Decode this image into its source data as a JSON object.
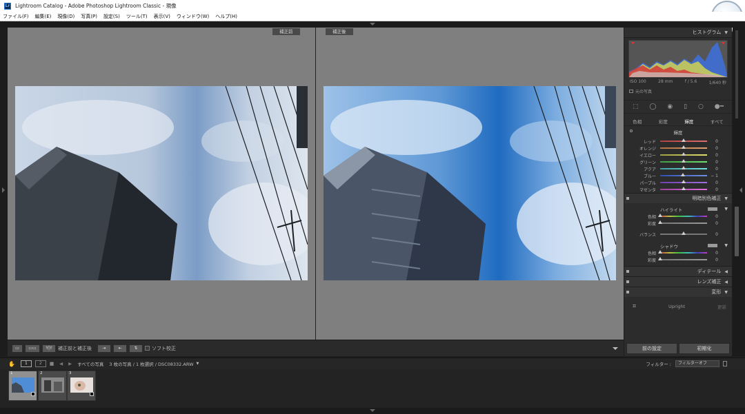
{
  "window": {
    "logo": "Lr",
    "title": "Lightroom Catalog - Adobe Photoshop Lightroom Classic - 現像"
  },
  "menu": [
    "ファイル(F)",
    "編集(E)",
    "現像(D)",
    "写真(P)",
    "設定(S)",
    "ツール(T)",
    "表示(V)",
    "ウィンドウ(W)",
    "ヘルプ(H)"
  ],
  "view": {
    "before_label": "補正前",
    "after_label": "補正後"
  },
  "toolbar": {
    "view_mode_label": "補正前と補正後",
    "soft_proof_label": "ソフト校正",
    "yy_label": "Y|Y"
  },
  "right_panel": {
    "histogram_title": "ヒストグラム",
    "exif": [
      "ISO 100",
      "28 mm",
      "f / 5.6",
      "1/640 秒"
    ],
    "original_photo_label": "元の写真",
    "hsl_tabs": [
      "色相",
      "彩度",
      "輝度",
      "すべて"
    ],
    "hsl_active_tab": "輝度",
    "hsl_section_title": "輝度",
    "hsl_sliders": [
      {
        "label": "レッド",
        "value": "0",
        "pos": 0.5,
        "colors": [
          "#b04040",
          "#e07070"
        ]
      },
      {
        "label": "オレンジ",
        "value": "0",
        "pos": 0.5,
        "colors": [
          "#b07040",
          "#e0a070"
        ]
      },
      {
        "label": "イエロー",
        "value": "0",
        "pos": 0.5,
        "colors": [
          "#a0a040",
          "#e0e070"
        ]
      },
      {
        "label": "グリーン",
        "value": "0",
        "pos": 0.5,
        "colors": [
          "#40a040",
          "#70e070"
        ]
      },
      {
        "label": "アクア",
        "value": "0",
        "pos": 0.5,
        "colors": [
          "#40a0a0",
          "#70e0e0"
        ]
      },
      {
        "label": "ブルー",
        "value": "− 1",
        "pos": 0.49,
        "colors": [
          "#3050b0",
          "#7090e0"
        ]
      },
      {
        "label": "パープル",
        "value": "0",
        "pos": 0.5,
        "colors": [
          "#7040b0",
          "#a070e0"
        ]
      },
      {
        "label": "マゼンタ",
        "value": "0",
        "pos": 0.5,
        "colors": [
          "#a040a0",
          "#e070e0"
        ]
      }
    ],
    "split_toning_title": "明暗別色補正",
    "highlights_label": "ハイライト",
    "highlights_sliders": [
      {
        "label": "色相",
        "value": "0",
        "pos": 0.0,
        "colors": [
          "#c04040",
          "#c0c040",
          "#40c040",
          "#40c0c0",
          "#4040c0",
          "#c040c0"
        ]
      },
      {
        "label": "彩度",
        "value": "0",
        "pos": 0.0,
        "colors": [
          "#777777",
          "#999999"
        ]
      }
    ],
    "balance_label": "バランス",
    "balance_value": "0",
    "shadows_label": "シャドウ",
    "shadows_sliders": [
      {
        "label": "色相",
        "value": "0",
        "pos": 0.0,
        "colors": [
          "#c04040",
          "#c0c040",
          "#40c040",
          "#40c0c0",
          "#4040c0",
          "#c040c0"
        ]
      },
      {
        "label": "彩度",
        "value": "0",
        "pos": 0.0,
        "colors": [
          "#777777",
          "#999999"
        ]
      }
    ],
    "detail_title": "ディテール",
    "lens_title": "レンズ補正",
    "transform_title": "変形",
    "upright_label": "Upright",
    "update_label": "更新",
    "prev_button": "前の設定",
    "reset_button": "初期化"
  },
  "filmstrip_bar": {
    "page1": "1",
    "page2": "2",
    "source": "すべての写真",
    "count": "3 枚の写真 / 1 枚選択 / DSC08332.ARW",
    "filter_label": "フィルター :",
    "filter_value": "フィルターオフ"
  },
  "thumbnails": [
    {
      "num": "1",
      "selected": true
    },
    {
      "num": "2",
      "selected": false
    },
    {
      "num": "3",
      "selected": false
    }
  ]
}
